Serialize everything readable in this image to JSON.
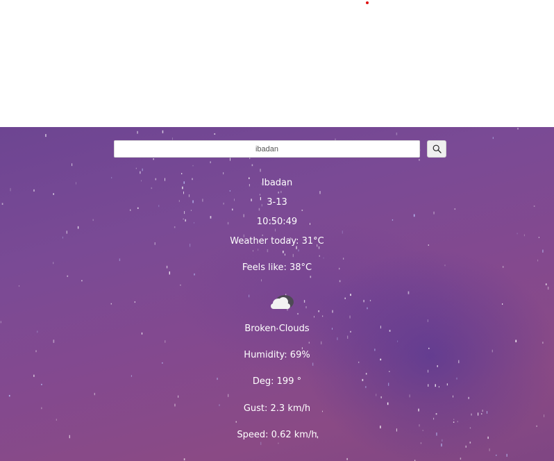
{
  "search": {
    "value": "ibadan",
    "button_icon": "search-icon"
  },
  "weather": {
    "city": "Ibadan",
    "date": "3-13",
    "time": "10:50:49",
    "today": "Weather today: 31°C",
    "feels_like": "Feels like: 38°C",
    "icon": "broken-clouds-icon",
    "description": "Broken Clouds",
    "humidity": "Humidity: 69%",
    "deg": "Deg: 199 °",
    "gust": "Gust: 2.3 km/h",
    "speed": "Speed: 0.62 km/h"
  },
  "colors": {
    "background_start": "#6d4592",
    "background_end": "#8a4a85",
    "text": "#ffffff",
    "indicator": "#e01010"
  }
}
